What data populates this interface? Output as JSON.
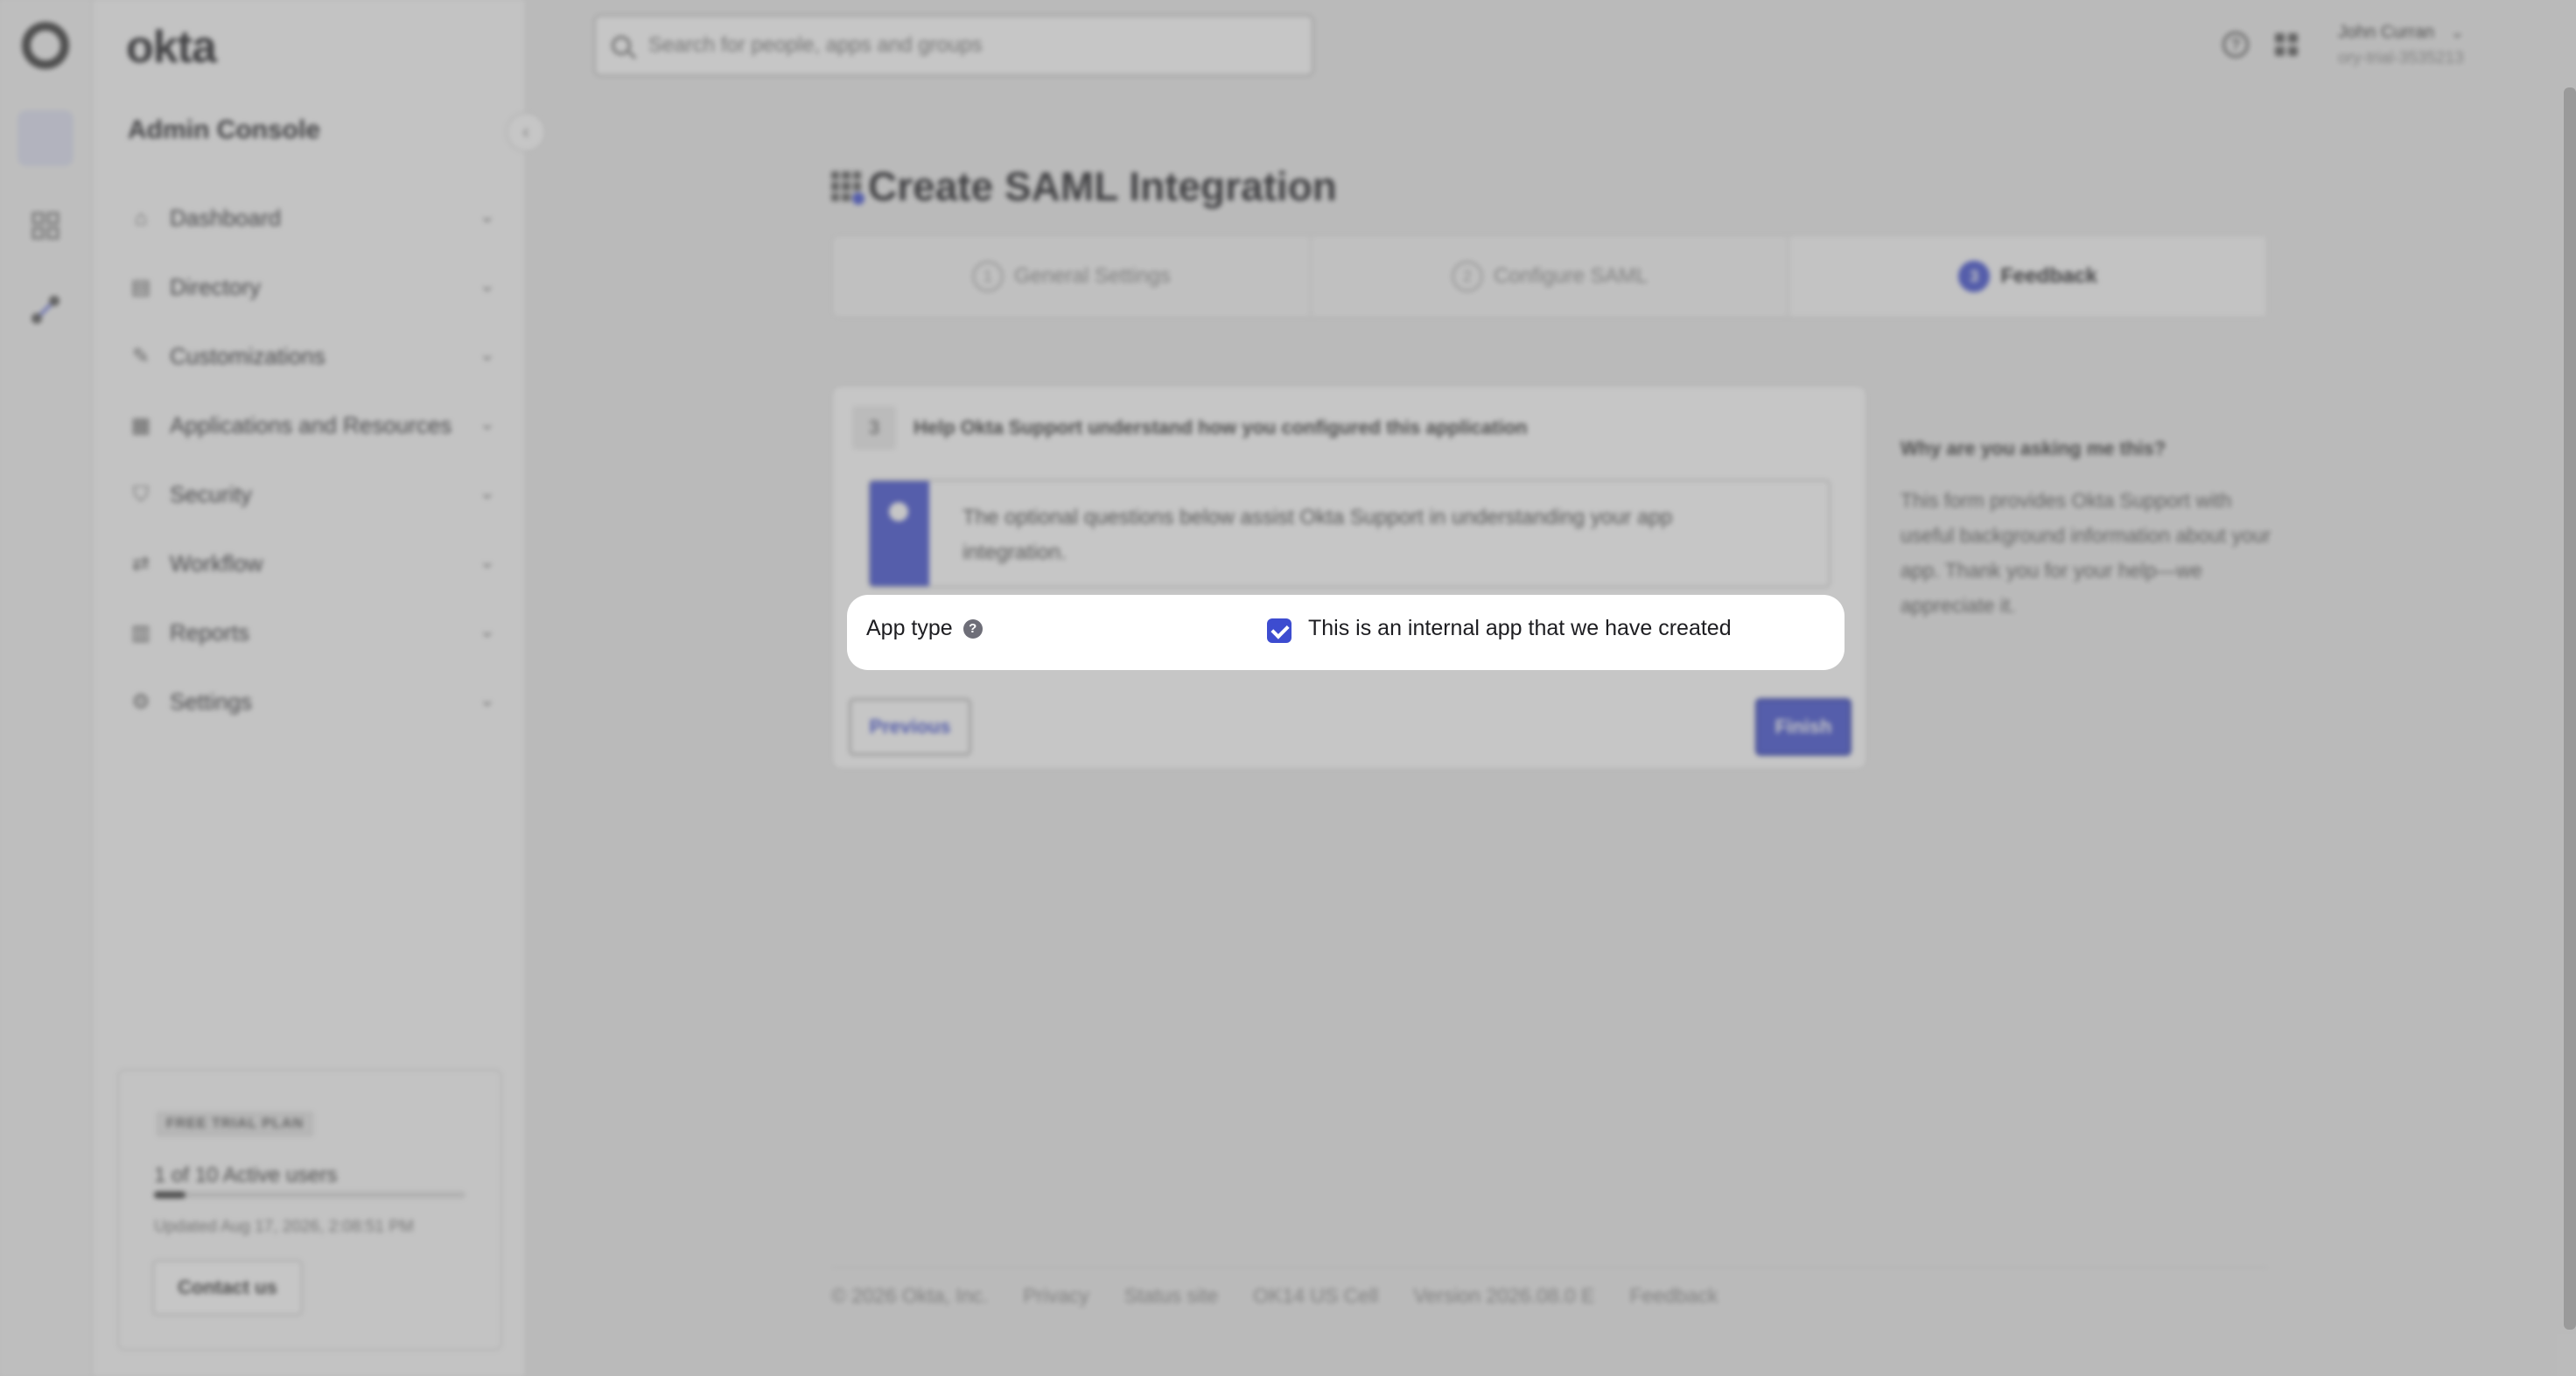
{
  "app": {
    "logo_text": "okta",
    "console_title": "Admin Console"
  },
  "search": {
    "placeholder": "Search for people, apps and groups"
  },
  "user": {
    "name": "John Curran",
    "org": "ory-trial-3535213"
  },
  "nav": {
    "items": [
      {
        "label": "Dashboard",
        "icon": "home-icon"
      },
      {
        "label": "Directory",
        "icon": "directory-icon"
      },
      {
        "label": "Customizations",
        "icon": "brush-icon"
      },
      {
        "label": "Applications and Resources",
        "icon": "apps-icon"
      },
      {
        "label": "Security",
        "icon": "shield-icon"
      },
      {
        "label": "Workflow",
        "icon": "workflow-icon"
      },
      {
        "label": "Reports",
        "icon": "reports-icon"
      },
      {
        "label": "Settings",
        "icon": "gear-icon"
      }
    ]
  },
  "trial": {
    "badge": "FREE TRIAL PLAN",
    "users": "1 of 10 Active users",
    "users_progress_fraction": 0.1,
    "updated": "Updated Aug 17, 2026, 2:08:51 PM",
    "contact_label": "Contact us"
  },
  "page": {
    "title": "Create SAML Integration"
  },
  "steps": [
    {
      "num": "1",
      "label": "General Settings"
    },
    {
      "num": "2",
      "label": "Configure SAML"
    },
    {
      "num": "3",
      "label": "Feedback"
    }
  ],
  "card": {
    "step_num": "3",
    "header": "Help Okta Support understand how you configured this application",
    "callout": "The optional questions below assist Okta Support in understanding your app integration.",
    "app_type_label": "App type",
    "checkbox_label": "This is an internal app that we have created",
    "previous_label": "Previous",
    "finish_label": "Finish"
  },
  "help": {
    "title": "Why are you asking me this?",
    "body": "This form provides Okta Support with useful background information about your app. Thank you for your help—we appreciate it."
  },
  "footer": {
    "items": [
      "© 2026 Okta, Inc.",
      "Privacy",
      "Status site",
      "OK14 US Cell",
      "Version 2026.08.0 E",
      "Feedback"
    ]
  },
  "colors": {
    "accent": "#3d4cd0"
  }
}
